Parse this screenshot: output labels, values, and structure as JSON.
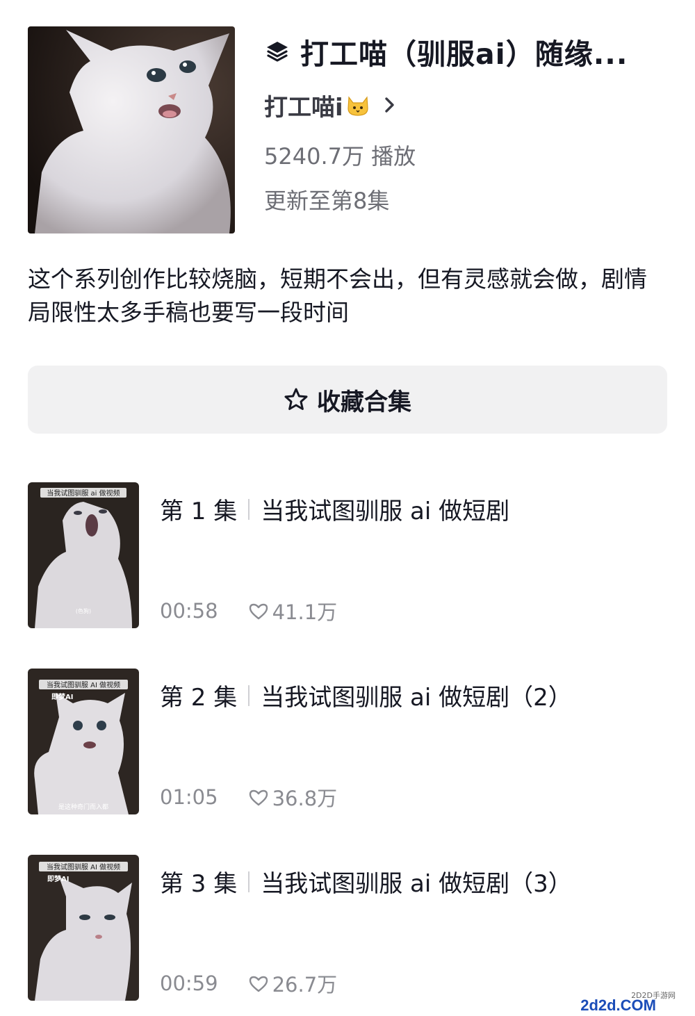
{
  "collection": {
    "title": "打工喵（驯服ai）随缘...",
    "author": "打工喵i",
    "author_emoji": "cat-face",
    "play_count": "5240.7万 播放",
    "update_status": "更新至第8集",
    "description": "这个系列创作比较烧脑，短期不会出，但有灵感就会做，剧情局限性太多手稿也要写一段时间",
    "collect_button_label": "收藏合集"
  },
  "episodes": [
    {
      "number_label": "第 1 集",
      "title": "当我试图驯服 ai 做短剧",
      "duration": "00:58",
      "likes": "41.1万",
      "thumb_caption_top": "当我试图驯服 ai 做视频",
      "thumb_caption_bottom": "(色狗)"
    },
    {
      "number_label": "第 2 集",
      "title": "当我试图驯服 ai 做短剧（2）",
      "duration": "01:05",
      "likes": "36.8万",
      "thumb_caption_top": "当我试图驯服 AI 做视频",
      "thumb_brand": "即梦AI",
      "thumb_caption_bottom": "是这种奇门而入都"
    },
    {
      "number_label": "第 3 集",
      "title": "当我试图驯服 ai 做短剧（3）",
      "duration": "00:59",
      "likes": "26.7万",
      "thumb_caption_top": "当我试图驯服 AI 做视频",
      "thumb_brand": "即梦AI"
    }
  ],
  "watermark": {
    "site_name": "2D2D手游网",
    "logo_text": "2d2d.COM"
  },
  "colors": {
    "primary_text": "#161823",
    "secondary_text": "#6d6e75",
    "meta_text": "#8a8b91",
    "button_bg": "#f1f1f2"
  }
}
